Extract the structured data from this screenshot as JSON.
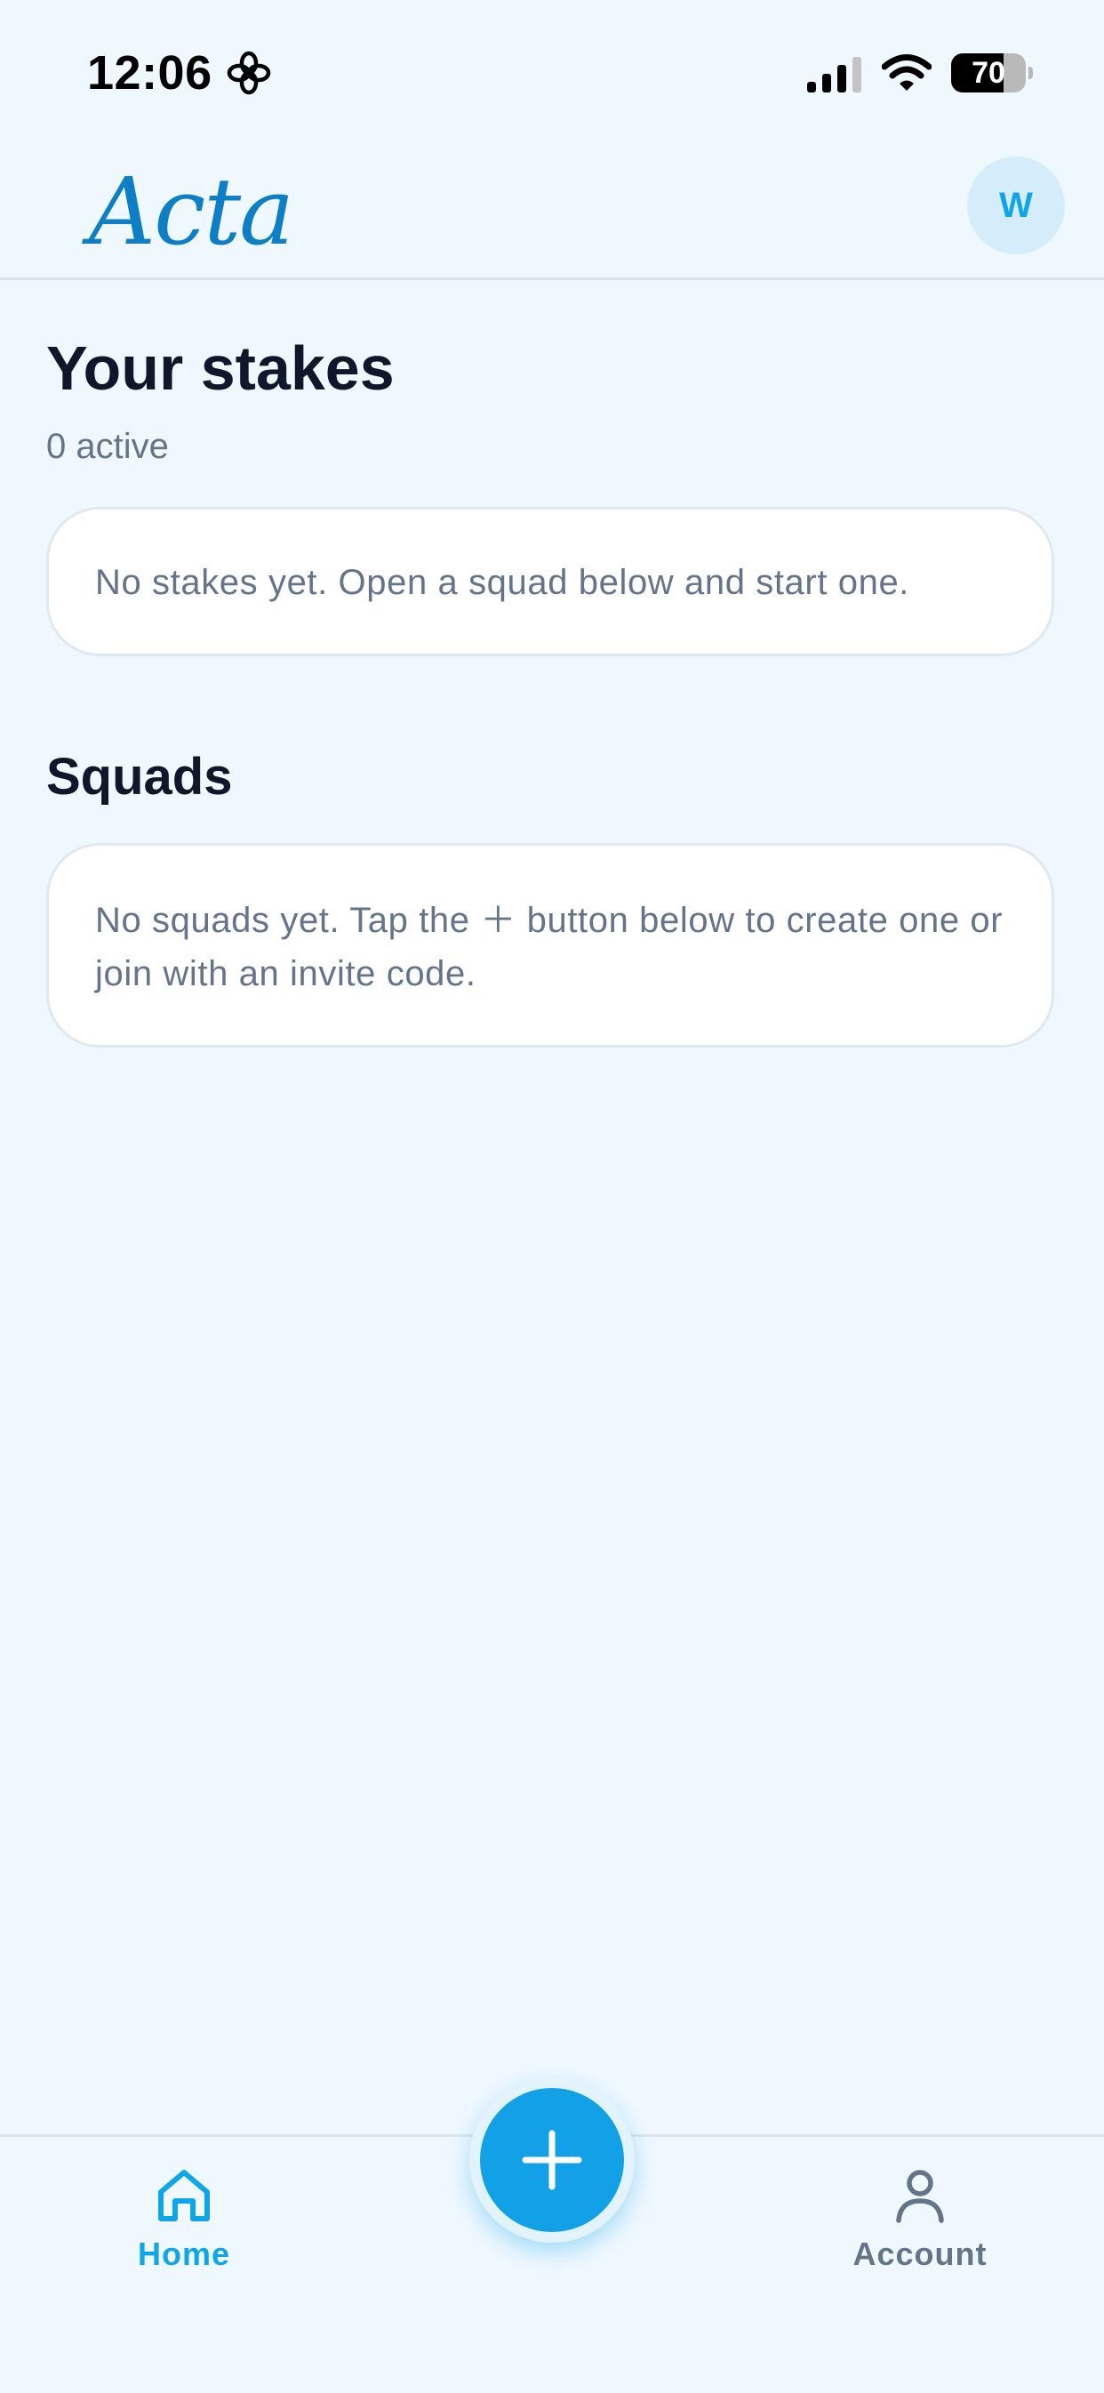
{
  "status_bar": {
    "time": "12:06",
    "battery_level": "70",
    "battery_fraction": 0.7,
    "icons": [
      "flower-icon",
      "cellular-signal-icon",
      "wifi-icon",
      "battery-icon"
    ]
  },
  "header": {
    "logo": "Acta",
    "avatar_initial": "W",
    "brand_color": "#0e7fc4",
    "accent_color": "#0ea5e9"
  },
  "stakes": {
    "title": "Your stakes",
    "count_label": "0 active",
    "empty_message": "No stakes yet. Open a squad below and start one."
  },
  "squads": {
    "title": "Squads",
    "empty_message": "No squads yet. Tap the ＋ button below to create one or join with an invite code."
  },
  "tab_bar": {
    "home_label": "Home",
    "account_label": "Account",
    "home_icon": "house-icon",
    "account_icon": "person-icon",
    "add_icon": "plus-icon",
    "active_tab": "Home"
  }
}
